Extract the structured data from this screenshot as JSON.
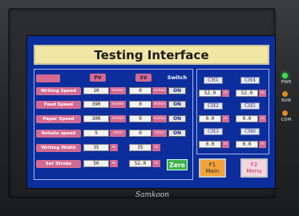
{
  "device": {
    "brand": "Samkoon",
    "indicators": [
      {
        "label": "PWR",
        "color": "#3ddc57"
      },
      {
        "label": "RUN",
        "color": "#e08a2a"
      },
      {
        "label": "COM",
        "color": "#e08a2a"
      }
    ]
  },
  "screen": {
    "title": "Testing Interface",
    "headers": {
      "pv": "PV",
      "sv": "SV",
      "switch": "Switch"
    },
    "rows": [
      {
        "label": "Writing Speed",
        "pv": "10",
        "pv_unit": "m/min",
        "sv": "0",
        "sv_unit": "m/min",
        "switch": "ON"
      },
      {
        "label": "Feed Speed",
        "pv": "390",
        "pv_unit": "m/min",
        "sv": "0",
        "sv_unit": "m/min",
        "switch": "ON"
      },
      {
        "label": "Paper Speed",
        "pv": "300",
        "pv_unit": "m/min",
        "sv": "0",
        "sv_unit": "m/min",
        "switch": "ON"
      },
      {
        "label": "Rotalio speed",
        "pv": "5",
        "pv_unit": "r/min",
        "sv": "0",
        "sv_unit": "r/min",
        "switch": "ON"
      },
      {
        "label": "Writing Width",
        "pv": "35",
        "pv_unit": "m",
        "sv": "35",
        "sv_unit": "m"
      },
      {
        "label": "Set Stroke",
        "pv": "50",
        "pv_unit": "m",
        "sv": "52.0",
        "sv_unit": "m"
      }
    ],
    "zero_button": "Zero",
    "channels": [
      {
        "left_label": "CH1",
        "right_label": "CH4",
        "left_value": "52.0",
        "right_value": "52.0",
        "left_unit": "m",
        "right_unit": "m"
      },
      {
        "left_label": "CH2",
        "right_label": "CH5",
        "left_value": "0.0",
        "right_value": "0.0",
        "left_unit": "m",
        "right_unit": "m"
      },
      {
        "left_label": "CH3",
        "right_label": "CH6",
        "left_value": "0.0",
        "right_value": "0.0",
        "left_unit": "m",
        "right_unit": "m"
      }
    ],
    "function_keys": [
      {
        "key": "F1",
        "label": "Main"
      },
      {
        "key": "F2",
        "label": "Menu"
      }
    ]
  }
}
